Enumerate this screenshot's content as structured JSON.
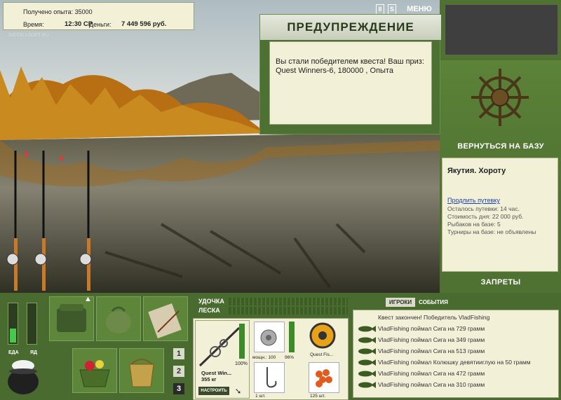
{
  "stats": {
    "exp_gained": "Получено опыта: 35000",
    "time_label": "Время:",
    "time_value": "12:30 СР",
    "money_label": "Деньги:",
    "money_value": "7 449 596 руб.",
    "watermark": "INSTALLSOFT.RU"
  },
  "top_icons": {
    "pause": "II",
    "settings": "S",
    "menu": "МЕНЮ"
  },
  "warning": {
    "title": "ПРЕДУПРЕЖДЕНИЕ",
    "message_line1": "Вы стали победителем квеста! Ваш приз:",
    "message_line2": "Quest Winners-6, 180000 , Опыта"
  },
  "right_panel": {
    "return_button": "ВЕРНУТЬСЯ НА БАЗУ",
    "location": "Якутия. Хороту",
    "extend_link": "Продлить путевку",
    "lines": [
      "Осталось путевки: 14 час.",
      "Стоимость дня: 22 000 руб.",
      "Рыбаков на базе: 5",
      "Турниры на базе: не объявлены"
    ],
    "bans_button": "ЗАПРЕТЫ"
  },
  "meters": {
    "food_label": "ЕДА",
    "poison_label": "ЯД",
    "food_level": 0.35,
    "poison_level": 0
  },
  "pages": [
    "1",
    "2",
    "3"
  ],
  "tackle": {
    "rod_label": "УДОЧКА",
    "line_label": "ЛЕСКА",
    "rod_name": "Quest Win...",
    "rod_weight": "355 кг",
    "rod_percent": "100%",
    "reel_power": "мощн.: 100",
    "reel_percent": "96%",
    "line_name": "Quest Fis...",
    "hook_count": "1 шт.",
    "bait_count": "125 шт.",
    "setup_button": "НАСТРОИТЬ"
  },
  "events": {
    "tab_players": "ИГРОКИ",
    "tab_events": "СОБЫТИЯ",
    "items": [
      "Квест закончен! Победитель VladFishing",
      "VladFishing поймал Сига на 729 грамм",
      "VladFishing поймал Сига на 349 грамм",
      "VladFishing поймал Сига на 513 грамм",
      "VladFishing поймал Колюшку девятииглую на 50 грамм",
      "VladFishing поймал Сига на 472 грамм",
      "VladFishing поймал Сига на 310 грамм"
    ]
  },
  "colors": {
    "panel_green": "#4f7232",
    "cream": "#f3f0d8",
    "link_blue": "#1b3fb0"
  }
}
